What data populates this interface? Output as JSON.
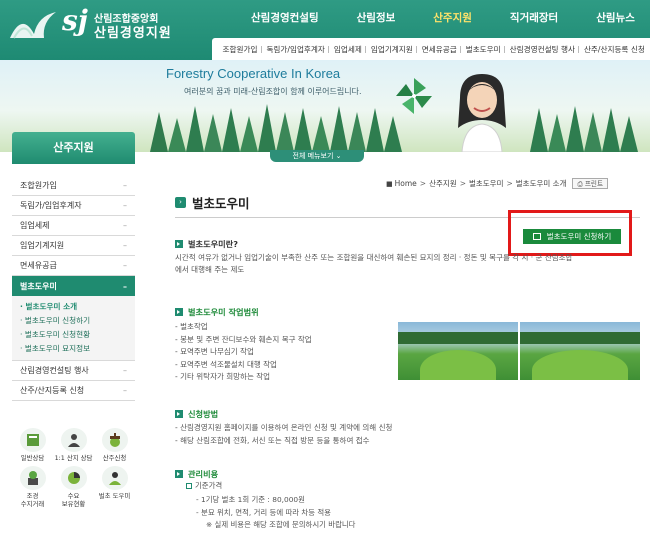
{
  "logo": {
    "sj": "sj",
    "line1": "산림조합중앙회",
    "line2": "산림경영지원"
  },
  "gnb": [
    {
      "label": "산림경영컨설팅"
    },
    {
      "label": "산림정보"
    },
    {
      "label": "산주지원",
      "active": true
    },
    {
      "label": "직거래장터"
    },
    {
      "label": "산림뉴스"
    }
  ],
  "subnav": [
    "조합원가입",
    "독림가/임업후계자",
    "임업세제",
    "임업기계지원",
    "면세유공급",
    "벌초도우미",
    "산림경영컨설팅 행사",
    "산주/산지등록 신청"
  ],
  "banner": {
    "slogan_1": "Forestry Cooperative",
    "slogan_2": "In Korea",
    "sub": "여러분의 꿈과 미래-산림조합이 함께 이루어드립니다.",
    "menu_all": "전체 메뉴보기 ⌄"
  },
  "sidebar": {
    "title": "산주지원",
    "items": [
      {
        "label": "조합원가입"
      },
      {
        "label": "독림가/임업후계자"
      },
      {
        "label": "임업세제"
      },
      {
        "label": "임업기계지원"
      },
      {
        "label": "면세유공급"
      },
      {
        "label": "벌초도우미",
        "active": true
      }
    ],
    "sub_items": [
      "벌초도우미 소개",
      "벌초도우미 신청하기",
      "벌초도우미 신청현황",
      "벌초도우미 묘지정보"
    ],
    "items_after": [
      {
        "label": "산림경영컨설팅 행사"
      },
      {
        "label": "산주/산지등록 신청"
      }
    ],
    "quick": [
      {
        "label": "일반상담",
        "icon": "book-icon"
      },
      {
        "label": "1:1 산지 상담",
        "icon": "person-chat-icon"
      },
      {
        "label": "산주신청",
        "icon": "acorn-icon"
      },
      {
        "label": "조경\n수지거래",
        "icon": "tree-pot-icon"
      },
      {
        "label": "수요\n보유현황",
        "icon": "pie-chart-icon"
      },
      {
        "label": "벌초 도우미",
        "icon": "helper-person-icon"
      }
    ]
  },
  "breadcrumb": {
    "home": "Home",
    "path": [
      "산주지원",
      "벌초도우미",
      "벌초도우미 소개"
    ],
    "print": "프린트"
  },
  "page": {
    "title": "벌초도우미",
    "apply_button": "벌초도우미 신청하기",
    "sec1_title": "벌초도우미란?",
    "sec1_text_1": "시간적 여유가 없거나 임업기술이 부족한 산주 또는 조합원을 대신하여 훼손된 묘지의 정리 · 정돈 및 복구를 각 시 · 군 산림조합",
    "sec1_text_2": "에서 대행해 주는 제도",
    "sec2_title": "벌초도우미 작업범위",
    "sec2_items": [
      "벌초작업",
      "봉분 및 주변 잔디보수와 훼손지 복구 작업",
      "묘역주변 나무심기 작업",
      "묘역주변 석조물설치 대행 작업",
      "기타 위탁자가 희망하는 작업"
    ],
    "sec3_title": "신청방법",
    "sec3_items": [
      "산림경영지원 홈페이지를 이용하여 온라인 신청 및 계약에 의해 신청",
      "해당 산림조합에 전화, 서신 또는 직접 방문 등을 통하여 접수"
    ],
    "sec4_title": "관리비용",
    "cost_label": "기준가격",
    "cost_item_1": "1기당 벌초 1회 기준 : 80,000원",
    "cost_item_2": "분묘 위치, 면적, 거리 등에 따라 차등 적용",
    "cost_note": "※ 실제 비용은 해당 조합에 문의하시기 바랍니다"
  },
  "colors": {
    "header": "#1e8a73",
    "accent_green": "#1f8b70",
    "apply_button": "#1a8a3c",
    "highlight_border": "#e21919",
    "gnb_active": "#ffe36a"
  }
}
